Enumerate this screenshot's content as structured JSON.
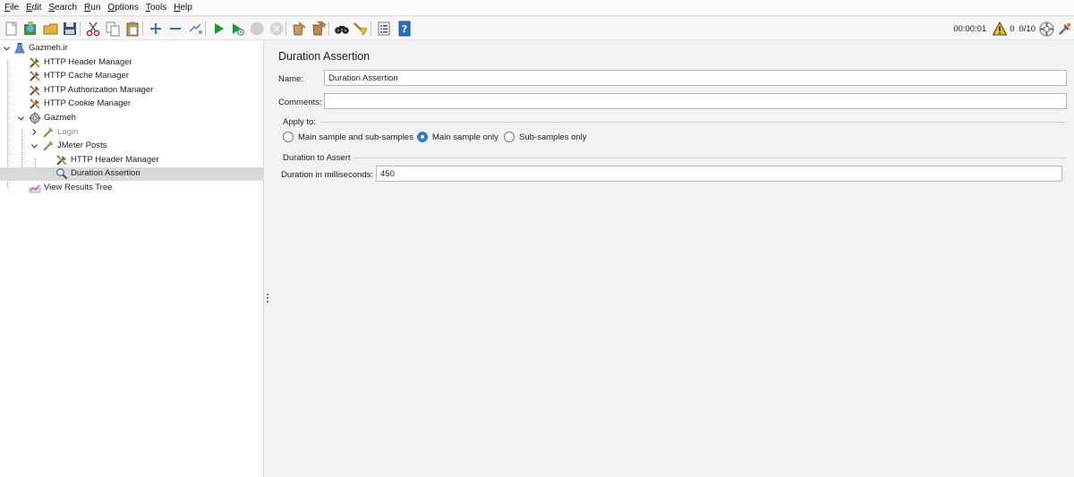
{
  "menu": [
    {
      "mnemonic": "F",
      "rest": "ile"
    },
    {
      "mnemonic": "E",
      "rest": "dit"
    },
    {
      "mnemonic": "S",
      "rest": "earch"
    },
    {
      "mnemonic": "R",
      "rest": "un"
    },
    {
      "mnemonic": "O",
      "rest": "ptions"
    },
    {
      "mnemonic": "T",
      "rest": "ools"
    },
    {
      "mnemonic": "H",
      "rest": "elp"
    }
  ],
  "toolbar": {
    "icons": [
      "new-icon",
      "templates-icon",
      "open-icon",
      "save-icon",
      "cut-icon",
      "copy-icon",
      "paste-icon",
      "expand-icon",
      "collapse-icon",
      "toggle-icon",
      "start-icon",
      "start-no-pause-icon",
      "stop-icon",
      "shutdown-icon",
      "clear-icon",
      "clear-all-icon",
      "search-icon",
      "reset-search-icon",
      "function-helper-icon",
      "help-icon"
    ],
    "timer": "00:00:01",
    "warnings": "0",
    "threads": "0/10"
  },
  "tree": {
    "nodes": [
      {
        "label": "Gazmeh.ir",
        "icon": "test-plan-icon",
        "level": 0,
        "expanded": true
      },
      {
        "label": "HTTP Header Manager",
        "icon": "config-element-icon",
        "level": 1
      },
      {
        "label": "HTTP Cache Manager",
        "icon": "config-element-icon",
        "level": 1
      },
      {
        "label": "HTTP Authorization Manager",
        "icon": "config-element-icon",
        "level": 1
      },
      {
        "label": "HTTP Cookie Manager",
        "icon": "config-element-icon",
        "level": 1
      },
      {
        "label": "Gazmeh",
        "icon": "thread-group-icon",
        "level": 1,
        "expanded": true
      },
      {
        "label": "Login",
        "icon": "sampler-icon",
        "level": 2,
        "expanded": false,
        "disabled": true
      },
      {
        "label": "JMeter Posts",
        "icon": "sampler-icon",
        "level": 2,
        "expanded": true
      },
      {
        "label": "HTTP Header Manager",
        "icon": "config-element-icon",
        "level": 3
      },
      {
        "label": "Duration Assertion",
        "icon": "assertion-icon",
        "level": 3,
        "selected": true
      },
      {
        "label": "View Results Tree",
        "icon": "listener-icon",
        "level": 1
      }
    ]
  },
  "panel": {
    "title": "Duration Assertion",
    "name_label": "Name:",
    "name_value": "Duration Assertion",
    "comments_label": "Comments:",
    "comments_value": "",
    "apply_to": {
      "title": "Apply to:",
      "options": [
        "Main sample and sub-samples",
        "Main sample only",
        "Sub-samples only"
      ],
      "selected": "Main sample only"
    },
    "duration_group": {
      "title": "Duration to Assert",
      "label": "Duration in milliseconds:",
      "value": "450"
    }
  },
  "colors": {
    "accent": "#2e7bd6",
    "selection": "#d9d9d9",
    "play": "#1a9b3c",
    "warning": "#f2c200"
  }
}
